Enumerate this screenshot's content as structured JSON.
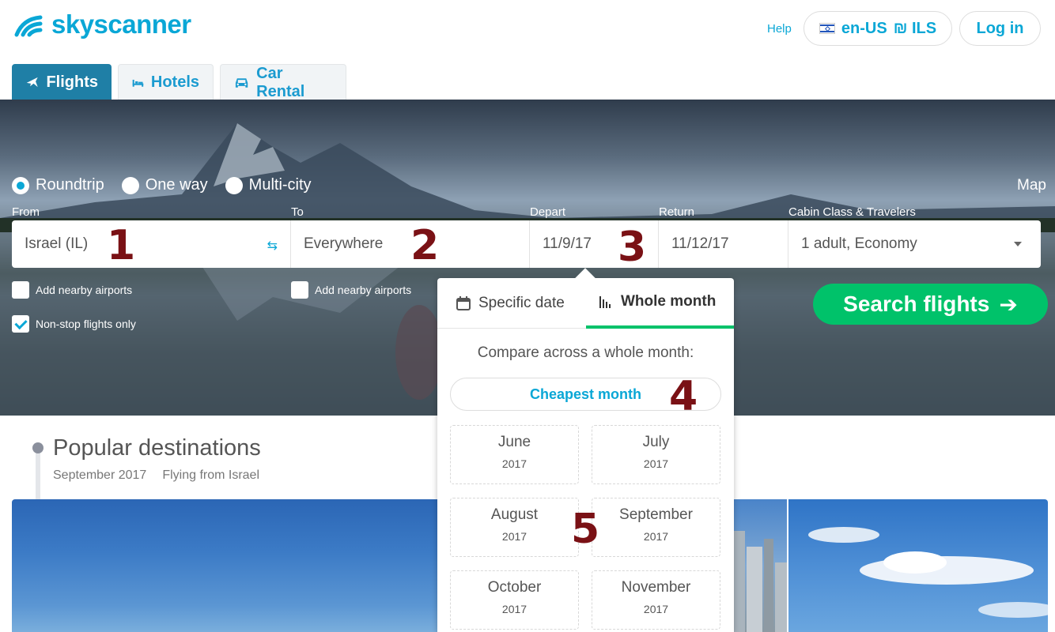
{
  "header": {
    "logo_text": "skyscanner",
    "help": "Help",
    "locale_lang": "en-US",
    "locale_currency": "₪ ILS",
    "login": "Log in"
  },
  "tabs": [
    {
      "label": "Flights",
      "icon": "plane-icon",
      "active": true
    },
    {
      "label": "Hotels",
      "icon": "bed-icon",
      "active": false
    },
    {
      "label": "Car Rental",
      "icon": "car-icon",
      "active": false
    }
  ],
  "trip_types": [
    {
      "label": "Roundtrip",
      "selected": true
    },
    {
      "label": "One way",
      "selected": false
    },
    {
      "label": "Multi-city",
      "selected": false
    }
  ],
  "map_link": "Map",
  "search": {
    "from_label": "From",
    "from_value": "Israel (IL)",
    "to_label": "To",
    "to_value": "Everywhere",
    "depart_label": "Depart",
    "depart_value": "11/9/17",
    "return_label": "Return",
    "return_value": "11/12/17",
    "cabin_label": "Cabin Class & Travelers",
    "cabin_value": "1 adult, Economy",
    "nearby_from": "Add nearby airports",
    "nearby_to": "Add nearby airports",
    "nonstop": "Non-stop flights only",
    "nearby_from_checked": false,
    "nearby_to_checked": false,
    "nonstop_checked": true,
    "button": "Search flights"
  },
  "annotations": [
    "1",
    "2",
    "3",
    "4",
    "5"
  ],
  "date_popup": {
    "tab_specific": "Specific date",
    "tab_whole": "Whole month",
    "active_tab": "Whole month",
    "compare_text": "Compare across a whole month:",
    "cheapest": "Cheapest month",
    "months": [
      {
        "name": "June",
        "year": "2017"
      },
      {
        "name": "July",
        "year": "2017"
      },
      {
        "name": "August",
        "year": "2017"
      },
      {
        "name": "September",
        "year": "2017"
      },
      {
        "name": "October",
        "year": "2017"
      },
      {
        "name": "November",
        "year": "2017"
      }
    ]
  },
  "popular": {
    "title": "Popular destinations",
    "month": "September 2017",
    "flying_from": "Flying from Israel"
  },
  "colors": {
    "brand": "#0aa7d6",
    "active_tab": "#1f7fa6",
    "search_button": "#00c26a",
    "annotation": "#7a1115"
  }
}
